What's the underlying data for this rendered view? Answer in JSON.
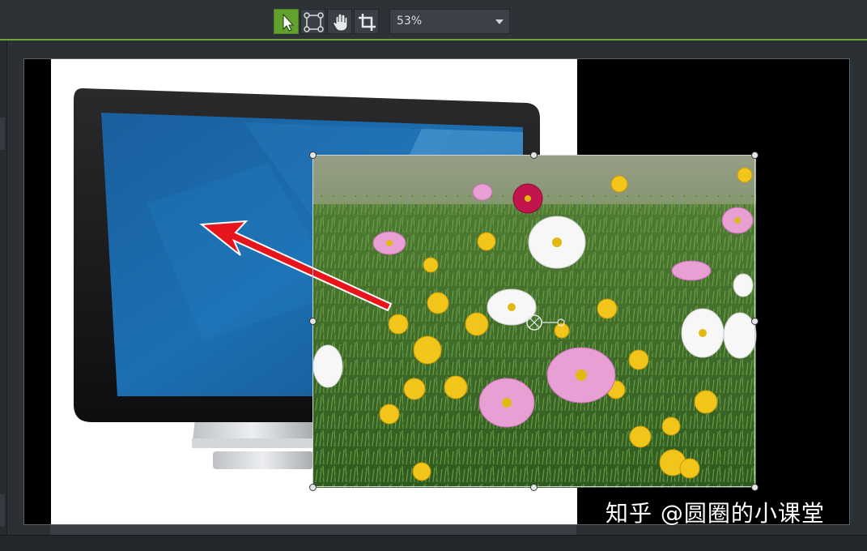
{
  "toolbar": {
    "tools": [
      {
        "name": "select-tool",
        "icon": "arrow-pointer-icon",
        "active": true
      },
      {
        "name": "transform-tool",
        "icon": "transform-handles-icon",
        "active": false
      },
      {
        "name": "pan-tool",
        "icon": "hand-icon",
        "active": false
      },
      {
        "name": "crop-tool",
        "icon": "crop-icon",
        "active": false
      }
    ],
    "zoom": {
      "value": "53%",
      "icon": "chevron-down-icon"
    }
  },
  "canvas": {
    "layers": [
      {
        "name": "monitor-image",
        "description_icon": "monitor-icon"
      },
      {
        "name": "flowers-image",
        "selected": true
      },
      {
        "name": "red-arrow-annotation",
        "color": "#e8141b"
      }
    ]
  },
  "watermark": {
    "text": "知乎 @圆圈的小课堂"
  },
  "colors": {
    "accent": "#62a12b",
    "arrow": "#e8141b",
    "screen": "#1c6fb1"
  }
}
